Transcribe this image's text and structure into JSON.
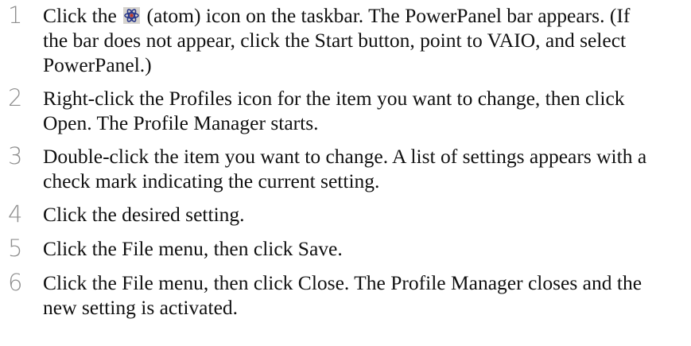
{
  "steps": [
    {
      "number": "1",
      "text_before_icon": "Click the ",
      "icon": "atom-icon",
      "text_after_icon": " (atom) icon on the taskbar. The PowerPanel bar appears. (If the bar does not appear, click the Start button, point to VAIO, and select PowerPanel.)"
    },
    {
      "number": "2",
      "text": "Right-click the Profiles icon for the item you want to change, then click Open. The Profile Manager starts."
    },
    {
      "number": "3",
      "text": "Double-click the item you want to change. A list of settings appears with a check mark indicating the current setting."
    },
    {
      "number": "4",
      "text": "Click the desired setting."
    },
    {
      "number": "5",
      "text": "Click the File menu, then click Save."
    },
    {
      "number": "6",
      "text": "Click the File menu, then click Close. The Profile Manager closes and the new setting is activated."
    }
  ],
  "colors": {
    "step_number": "#8f8f8f",
    "body_text": "#111111",
    "icon_background": "#d6d3ce",
    "icon_orbit": "#2b3a8c",
    "icon_nucleus": "#c0392b"
  }
}
